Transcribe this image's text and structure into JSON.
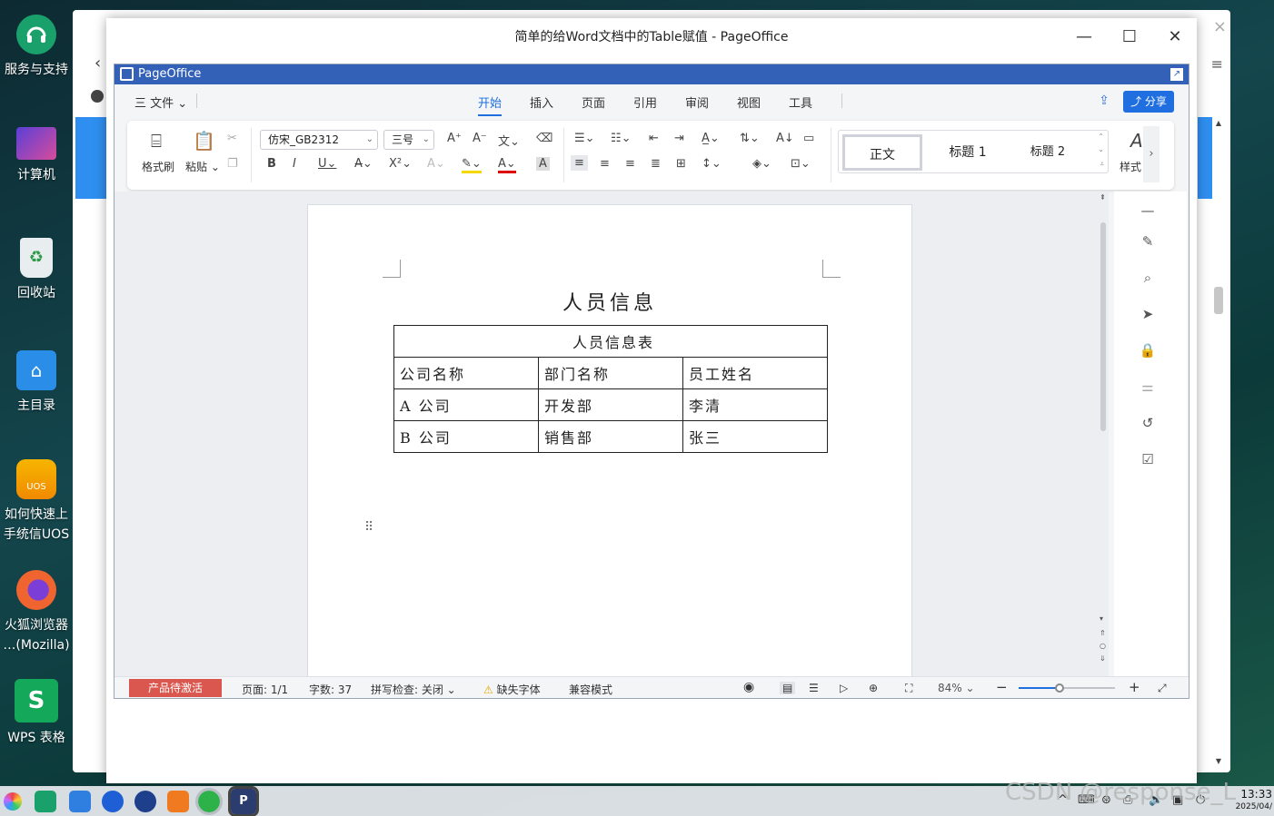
{
  "desktop": {
    "icons": [
      {
        "label": "服务与支持"
      },
      {
        "label": "计算机"
      },
      {
        "label": "回收站"
      },
      {
        "label": "主目录"
      },
      {
        "label": "如何快速上手统信UOS",
        "label1": "如何快速上",
        "label2": "手统信UOS",
        "badge": "UOS"
      },
      {
        "label1": "火狐浏览器",
        "label2": "…(Mozilla)"
      },
      {
        "label": "WPS 表格",
        "glyph": "S"
      }
    ]
  },
  "window": {
    "title": "简单的给Word文档中的Table赋值 - PageOffice"
  },
  "pageoffice": {
    "bar_title": "PageOffice",
    "file_menu": "三 文件 ⌄",
    "tabs": [
      "开始",
      "插入",
      "页面",
      "引用",
      "审阅",
      "视图",
      "工具"
    ],
    "active_tab": "开始",
    "share_label": "分享",
    "ribbon": {
      "format_painter": "格式刷",
      "paste": "粘贴 ⌄",
      "font_name": "仿宋_GB2312",
      "font_size": "三号",
      "styles": [
        "正文",
        "标题 1",
        "标题 2"
      ],
      "styles_label": "样式"
    },
    "document": {
      "title": "人员信息",
      "table": {
        "header": "人员信息表",
        "columns": [
          "公司名称",
          "部门名称",
          "员工姓名"
        ],
        "rows": [
          [
            "A 公司",
            "开发部",
            "李清"
          ],
          [
            "B 公司",
            "销售部",
            "张三"
          ]
        ]
      }
    },
    "status": {
      "activate": "产品待激活",
      "page": "页面: 1/1",
      "words": "字数: 37",
      "spell": "拼写检查: 关闭",
      "missing_font": "缺失字体",
      "compat": "兼容模式",
      "zoom": "84%",
      "zoom_fraction": 0.42
    }
  },
  "taskbar": {
    "clock_time": "13:33",
    "clock_date": "2025/04/"
  },
  "watermark": "CSDN @response_L"
}
